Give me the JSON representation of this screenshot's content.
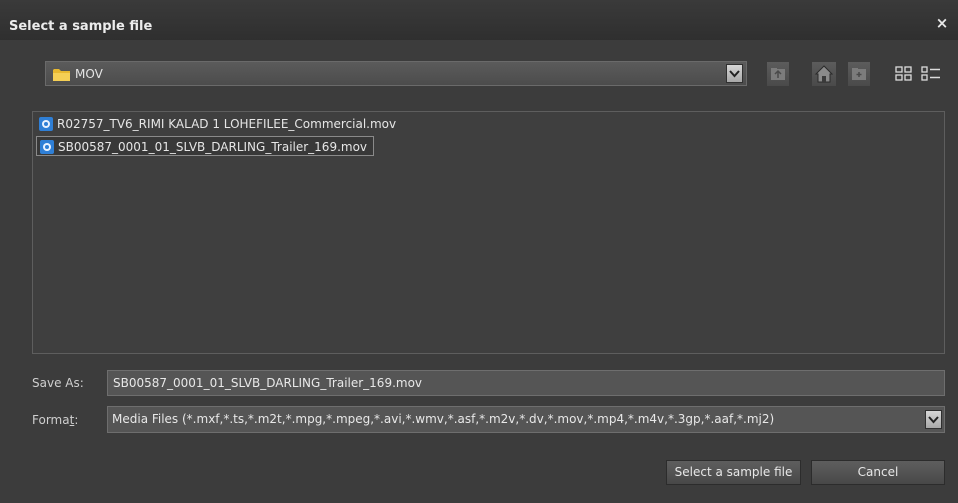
{
  "dialog": {
    "title": "Select a sample file",
    "close_glyph": "×"
  },
  "path_combo": {
    "folder_name": "MOV"
  },
  "toolbar": {
    "icons": [
      "folder-up-icon",
      "home-icon",
      "new-folder-icon",
      "thumbnail-view-icon",
      "list-view-icon"
    ]
  },
  "file_list": {
    "items": [
      {
        "name": "R02757_TV6_RIMI KALAD 1 LOHEFILEE_Commercial.mov",
        "selected": false
      },
      {
        "name": "SB00587_0001_01_SLVB_DARLING_Trailer_169.mov",
        "selected": true
      }
    ]
  },
  "save_as": {
    "label": "Save As:",
    "value": "SB00587_0001_01_SLVB_DARLING_Trailer_169.mov"
  },
  "format": {
    "label_prefix": "Forma",
    "label_accel": "t",
    "label_suffix": ":",
    "selected": "Media Files (*.mxf,*.ts,*.m2t,*.mpg,*.mpeg,*.avi,*.wmv,*.asf,*.m2v,*.dv,*.mov,*.mp4,*.m4v,*.3gp,*.aaf,*.mj2)"
  },
  "buttons": {
    "confirm": "Select a sample file",
    "cancel": "Cancel"
  },
  "colors": {
    "background": "#3c3c3c",
    "titlebar": "#2f2f2f",
    "selection_border": "#8a8a8a",
    "folder": "#e8b830"
  }
}
